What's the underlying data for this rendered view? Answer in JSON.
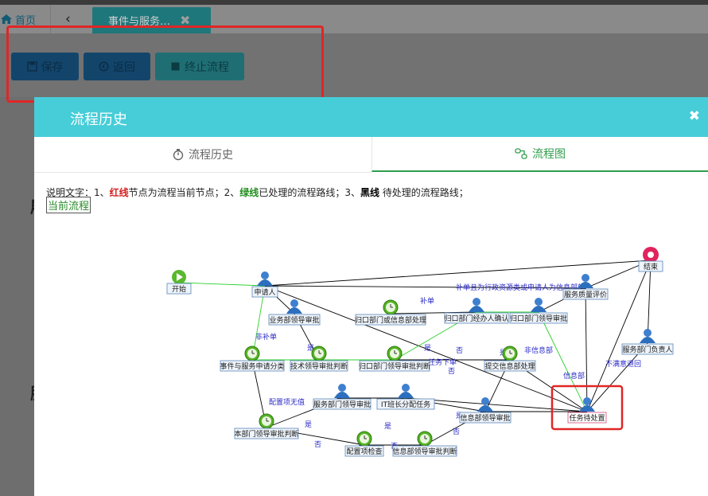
{
  "tabs": {
    "home_label": "首页",
    "active_tab_label": "事件与服务…"
  },
  "toolbar": {
    "save_label": "保存",
    "back_label": "返回",
    "stop_label": "终止流程"
  },
  "modal": {
    "title": "流程历史",
    "tabs": [
      {
        "label": "流程历史"
      },
      {
        "label": "流程图"
      }
    ],
    "legend": {
      "prefix": "说明文字：1、",
      "red": "红线",
      "part1": "节点为流程当前节点；2、",
      "green": "绿线",
      "part2": "已处理的流程路线；3、",
      "black": "黑线",
      "part3": " 待处理的流程路线；"
    },
    "current_label": "当前流程"
  },
  "flow": {
    "nodes": [
      {
        "id": "start",
        "label": "开始",
        "icon": "start-icon"
      },
      {
        "id": "applicant",
        "label": "申请人",
        "icon": "user-icon"
      },
      {
        "id": "biz_dept_review",
        "label": "业务部领导审批",
        "icon": "user-icon"
      },
      {
        "id": "dept_verify",
        "label": "归口部门或信息部处理",
        "icon": "clock-icon"
      },
      {
        "id": "dept_handler",
        "label": "归口部门经办人确认",
        "icon": "user-icon"
      },
      {
        "id": "dept_leader",
        "label": "归口部门领导审批",
        "icon": "user-icon"
      },
      {
        "id": "quality_eval",
        "label": "服务质量评价",
        "icon": "user-icon"
      },
      {
        "id": "end",
        "label": "结束",
        "icon": "end-icon"
      },
      {
        "id": "event_service",
        "label": "事件与服务申请分类",
        "icon": "clock-icon"
      },
      {
        "id": "tech_review",
        "label": "技术领导审批判断",
        "icon": "clock-icon"
      },
      {
        "id": "dept_judge",
        "label": "归口部门领导审批判断",
        "icon": "clock-icon"
      },
      {
        "id": "submit_info",
        "label": "提交信息部处理",
        "icon": "clock-icon"
      },
      {
        "id": "service_owner",
        "label": "服务部门负责人",
        "icon": "user-icon"
      },
      {
        "id": "local_review",
        "label": "本部门领导审批判断",
        "icon": "clock-icon"
      },
      {
        "id": "service_dept_review",
        "label": "服务部门领导审批",
        "icon": "user-icon"
      },
      {
        "id": "it_assign",
        "label": "IT班长分配任务",
        "icon": "user-icon"
      },
      {
        "id": "info_leader",
        "label": "信息部领导审批",
        "icon": "user-icon"
      },
      {
        "id": "task_pending",
        "label": "任务待处置",
        "icon": "user-icon",
        "current": true
      },
      {
        "id": "config_check",
        "label": "配置项检查",
        "icon": "clock-icon"
      },
      {
        "id": "info_judge",
        "label": "信息部领导审批判断",
        "icon": "clock-icon"
      }
    ],
    "edge_labels": [
      "补单且为行政资源类或申请人为信息部的",
      "补单",
      "非补单",
      "是",
      "否",
      "任务下单",
      "是",
      "否",
      "配置项无值",
      "是",
      "否",
      "是",
      "否",
      "是",
      "否",
      "信息部",
      "非信息部",
      "不满意退回",
      "是",
      "否"
    ]
  },
  "side_chars": [
    "履",
    "服"
  ],
  "colors": {
    "header_teal": "#46cdd8",
    "current_red": "#e02626",
    "green_line": "#2bd12b"
  }
}
